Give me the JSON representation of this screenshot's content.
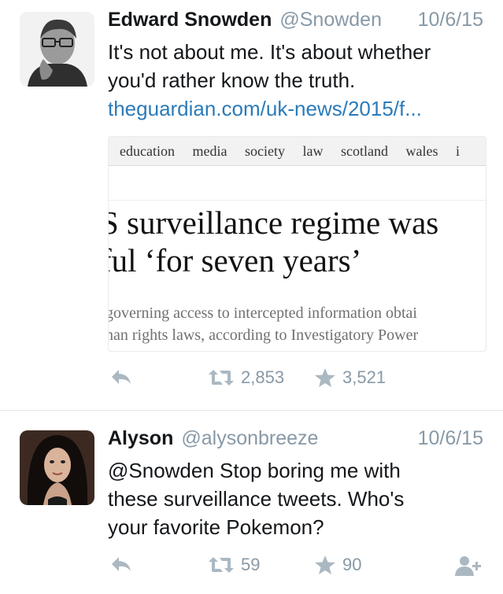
{
  "tweets": [
    {
      "name": "Edward Snowden",
      "handle": "@Snowden",
      "date": "10/6/15",
      "text_lines": [
        "It's not about me. It's about whether",
        "you'd rather know the truth."
      ],
      "link": "theguardian.com/uk-news/2015/f...",
      "card": {
        "nav_items": [
          "education",
          "media",
          "society",
          "law",
          "scotland",
          "wales",
          "i"
        ],
        "headline_lines": [
          "S surveillance regime was",
          "ful ‘for seven years’"
        ],
        "sub_lines": [
          "governing access to intercepted information obtai",
          "nan rights laws, according to Investigatory Power"
        ]
      },
      "retweets": "2,853",
      "favorites": "3,521"
    },
    {
      "name": "Alyson",
      "handle": "@alysonbreeze",
      "date": "10/6/15",
      "text_lines": [
        "@Snowden Stop boring me with",
        "these surveillance tweets. Who's",
        "your favorite Pokemon?"
      ],
      "retweets": "59",
      "favorites": "90"
    }
  ],
  "colors": {
    "link": "#2b7bb9",
    "muted": "#8899a6",
    "divider": "#e1e8ed"
  },
  "icons": [
    "reply-icon",
    "retweet-icon",
    "favorite-icon",
    "follow-icon"
  ]
}
